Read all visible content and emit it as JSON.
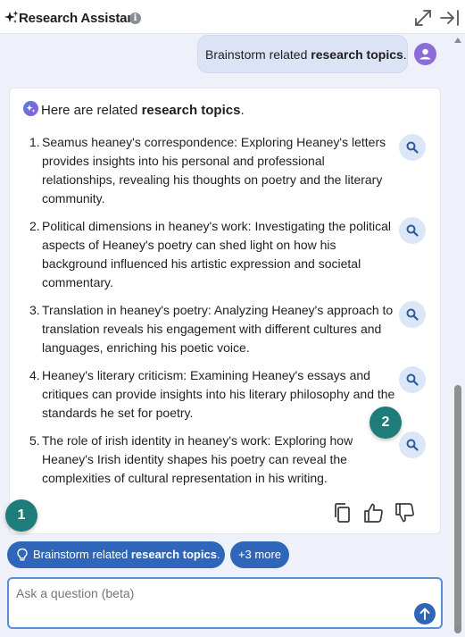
{
  "header": {
    "title": "Research Assistant",
    "info_glyph": "i",
    "icons": [
      "sparkle-icon",
      "info-icon",
      "expand-icon",
      "collapse-panel-icon"
    ]
  },
  "conversation": {
    "user_message": {
      "prefix": "Brainstorm related ",
      "bold": "research topics",
      "suffix": "."
    },
    "response": {
      "heading_prefix": "Here are related ",
      "heading_bold": "research topics",
      "heading_suffix": ".",
      "topics": [
        {
          "number": "1.",
          "text": "Seamus heaney's correspondence: Exploring Heaney's letters provides insights into his personal and professional relationships, revealing his thoughts on poetry and the literary community."
        },
        {
          "number": "2.",
          "text": "Political dimensions in heaney's work: Investigating the political aspects of Heaney's poetry can shed light on how his background influenced his artistic expression and societal commentary."
        },
        {
          "number": "3.",
          "text": "Translation in heaney's poetry: Analyzing Heaney's approach to translation reveals his engagement with different cultures and languages, enriching his poetic voice."
        },
        {
          "number": "4.",
          "text": "Heaney's literary criticism: Examining Heaney's essays and critiques can provide insights into his literary philosophy and the standards he set for poetry."
        },
        {
          "number": "5.",
          "text": "The role of irish identity in heaney's work: Exploring how Heaney's Irish identity shapes his poetry can reveal the complexities of cultural representation in his writing."
        }
      ],
      "actions": [
        "copy-icon",
        "thumbs-up-icon",
        "thumbs-down-icon"
      ]
    }
  },
  "badges": [
    "1",
    "2"
  ],
  "suggestions": {
    "main": {
      "prefix": "Brainstorm related ",
      "bold": "research topics",
      "suffix": "."
    },
    "more": "+3 more"
  },
  "input": {
    "placeholder": "Ask a question (beta)",
    "value": ""
  },
  "colors": {
    "accent": "#2f66ba",
    "badge": "#1e7c7a",
    "user_bubble": "#dde3f6",
    "avatar": "#8b6cd8",
    "search_button": "#dbe7f6"
  }
}
